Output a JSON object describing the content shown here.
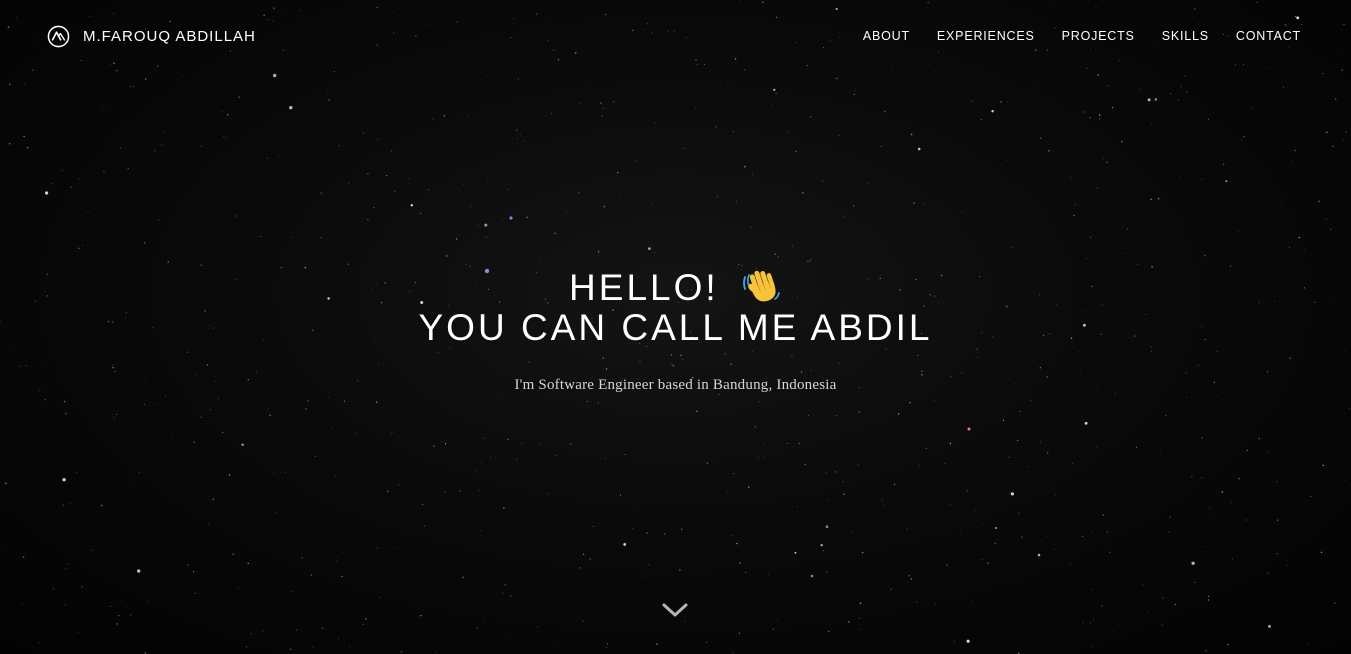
{
  "navbar": {
    "brand_name": "M.FAROUQ ABDILLAH",
    "logo_icon": "mountain-a-logo-icon",
    "links": [
      {
        "label": "ABOUT"
      },
      {
        "label": "EXPERIENCES"
      },
      {
        "label": "PROJECTS"
      },
      {
        "label": "SKILLS"
      },
      {
        "label": "CONTACT"
      }
    ]
  },
  "hero": {
    "greeting": "HELLO!",
    "greeting_icon": "waving-hand-icon",
    "headline": "YOU CAN CALL ME ABDIL",
    "subtitle": "I'm Software Engineer based in Bandung, Indonesia"
  },
  "scroll": {
    "icon": "chevron-down-icon"
  },
  "colors": {
    "background": "#050505",
    "text": "#ffffff",
    "subtitle": "#d6d6d6",
    "wave": "#f7c33b"
  }
}
